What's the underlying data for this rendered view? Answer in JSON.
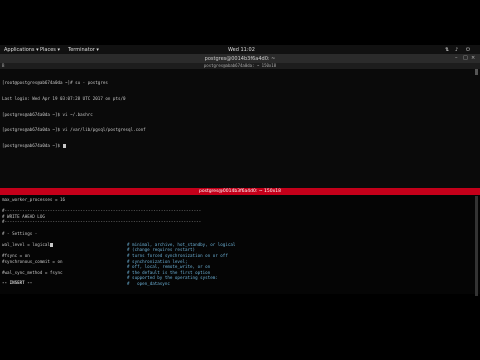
{
  "topbar": {
    "applications": "Applications ▾",
    "places": "Places ▾",
    "app": "Terminator ▾",
    "clock": "Wed 11:02"
  },
  "window1": {
    "title": "postgres@0014b3f6a4d0: ~",
    "subtitle": "postgres@abab674a0da: ~ 150x18",
    "menu": "B",
    "lines": [
      "[root@postgres@ab674a0da ~]# su - postgres",
      "Last login: Wed Apr 19 03:07:28 UTC 2017 on pts/0",
      "[postgres@ab674a0da ~]$ vi ~/.bashrc",
      "[postgres@ab674a0da ~]$ vi /var/lib/pgsql/postgresql.conf",
      "[postgres@ab674a0da ~]$ "
    ]
  },
  "window2": {
    "title": "postgres@0014b3f6a4d0: ~ 150x18",
    "lines": [
      "max_worker_processes = 16",
      "",
      "#------------------------------------------------------------------------------",
      "# WRITE AHEAD LOG",
      "#------------------------------------------------------------------------------",
      "",
      "# - Settings -",
      "",
      "wal_level = logical",
      "",
      "#fsync = on",
      "#synchronous_commit = on",
      "",
      "#wal_sync_method = fsync",
      "",
      "",
      "-- INSERT --"
    ],
    "comments": [
      {
        "row": 8,
        "text": "# minimal, archive, hot_standby, or logical"
      },
      {
        "row": 9,
        "text": "# (change requires restart)"
      },
      {
        "row": 10,
        "text": "# turns forced synchronization on or off"
      },
      {
        "row": 11,
        "text": "# synchronization level;"
      },
      {
        "row": 12,
        "text": "# off, local, remote_write, or on"
      },
      {
        "row": 13,
        "text": "# the default is the first option"
      },
      {
        "row": 14,
        "text": "# supported by the operating system:"
      },
      {
        "row": 15,
        "text": "#   open_datasync"
      }
    ]
  }
}
